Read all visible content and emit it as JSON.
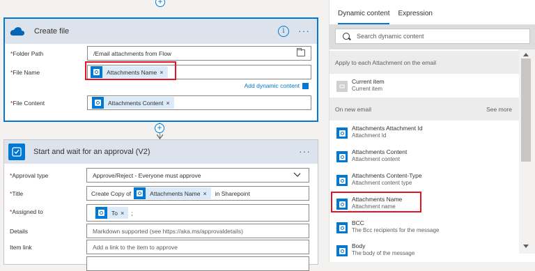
{
  "create_file": {
    "title": "Create file",
    "folder_path_label": "Folder Path",
    "folder_path_value": "/Email attachments from Flow",
    "file_name_label": "File Name",
    "file_name_token": "Attachments Name",
    "add_dynamic_content": "Add dynamic content",
    "file_content_label": "File Content",
    "file_content_token": "Attachments Content"
  },
  "approval": {
    "title": "Start and wait for an approval (V2)",
    "approval_type_label": "Approval type",
    "approval_type_value": "Approve/Reject - Everyone must approve",
    "title_label": "Title",
    "title_prefix": "Create Copy of",
    "title_token": "Attachments Name",
    "title_suffix": "in Sharepoint",
    "assigned_label": "Assigned to",
    "assigned_token": "To",
    "assigned_suffix": ";",
    "details_label": "Details",
    "details_placeholder": "Markdown supported (see https://aka.ms/approvaldetails)",
    "item_link_label": "Item link",
    "item_link_placeholder": "Add a link to the item to approve"
  },
  "panel": {
    "tab_dynamic": "Dynamic content",
    "tab_expression": "Expression",
    "search_placeholder": "Search dynamic content",
    "section_apply": "Apply to each Attachment on the email",
    "section_email": "On new email",
    "see_more": "See more",
    "items": [
      {
        "title": "Current item",
        "sub": "Current item"
      },
      {
        "title": "Attachments Attachment Id",
        "sub": "Attachment Id"
      },
      {
        "title": "Attachments Content",
        "sub": "Attachment content"
      },
      {
        "title": "Attachments Content-Type",
        "sub": "Attachment content type"
      },
      {
        "title": "Attachments Name",
        "sub": "Attachment name"
      },
      {
        "title": "BCC",
        "sub": "The Bcc recipients for the message"
      },
      {
        "title": "Body",
        "sub": "The body of the message"
      }
    ]
  },
  "colors": {
    "accent": "#0078d4",
    "highlight": "#e81123",
    "header": "#dde3ec"
  }
}
